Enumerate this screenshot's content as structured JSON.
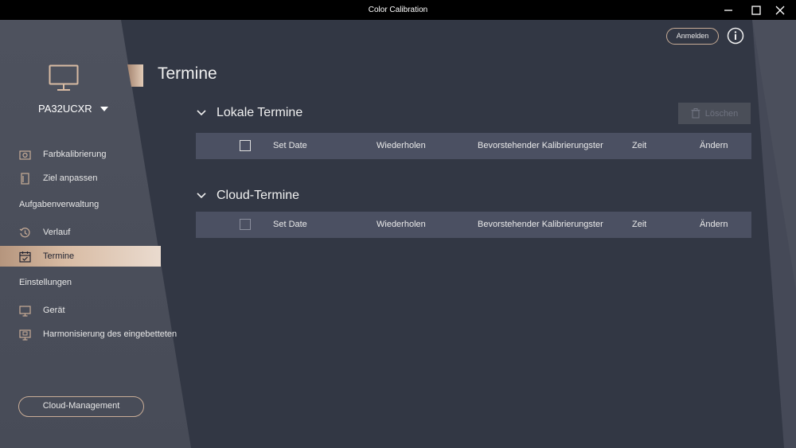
{
  "window": {
    "title": "Color Calibration"
  },
  "header": {
    "login_label": "Anmelden"
  },
  "sidebar": {
    "model": "PA32UCXR",
    "items": {
      "farbkalibrierung": "Farbkalibrierung",
      "ziel_anpassen": "Ziel anpassen",
      "verlauf": "Verlauf",
      "termine": "Termine",
      "geraet": "Gerät",
      "harmonisierung": "Harmonisierung des eingebetteten"
    },
    "sections": {
      "aufgaben": "Aufgabenverwaltung",
      "einstellungen": "Einstellungen"
    },
    "cloud_button": "Cloud-Management"
  },
  "main": {
    "title": "Termine",
    "delete_label": "Löschen",
    "local": {
      "title": "Lokale Termine",
      "columns": [
        "Set Date",
        "Wiederholen",
        "Bevorstehender Kalibrierungstermin",
        "Zeit",
        "Ändern"
      ]
    },
    "cloud": {
      "title": "Cloud-Termine",
      "columns": [
        "Set Date",
        "Wiederholen",
        "Bevorstehender Kalibrierungstermin",
        "Zeit",
        "Ändern"
      ]
    }
  },
  "colors": {
    "accent": "#c9ad97",
    "background": "#323744",
    "sidebar": "#4a4e5a",
    "table_header": "#4b5062"
  }
}
